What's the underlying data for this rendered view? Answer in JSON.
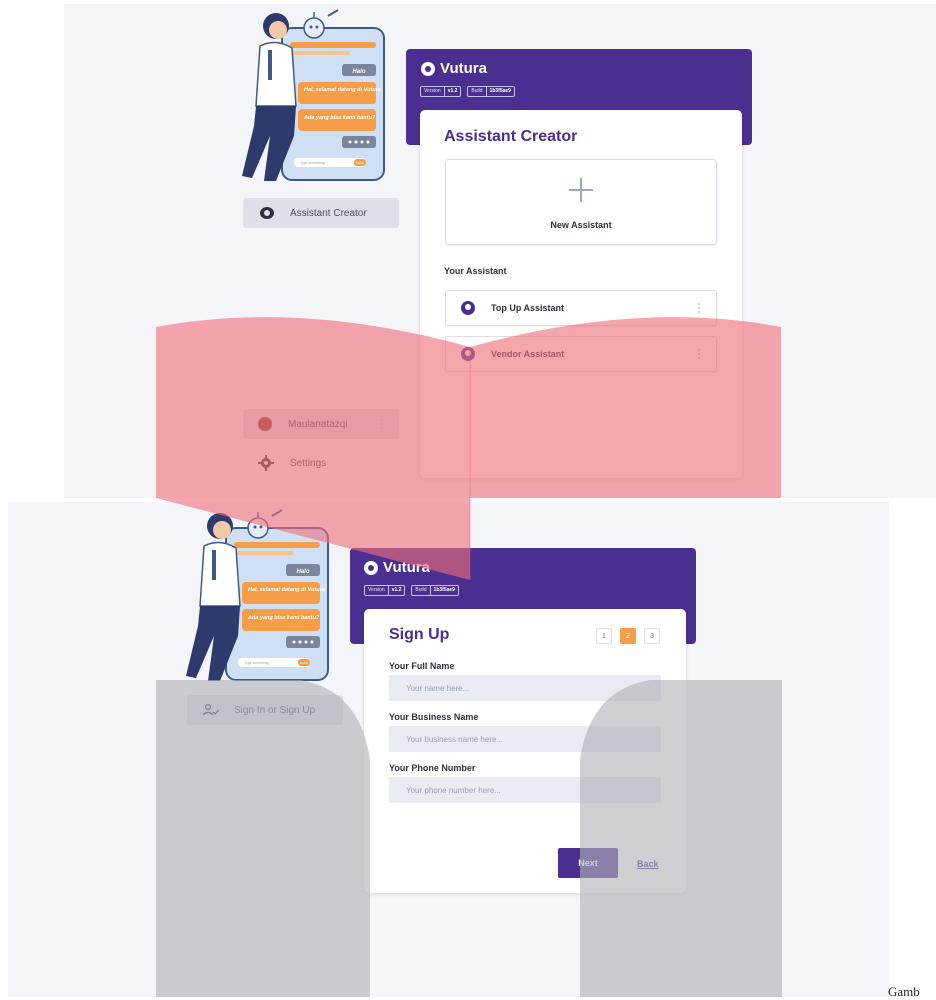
{
  "top": {
    "brand": "Vutura",
    "version_label": "Version",
    "version_value": "v1.2",
    "build_label": "Build",
    "build_value": "1b3f5ae9",
    "illustration": {
      "bubble_halo": "Halo",
      "bubble_greet": "Hai, selamat datang di Vutura",
      "bubble_ask": "Ada yang bisa kami bantu?",
      "input_hint": "Type something",
      "send": "SEND"
    },
    "nav_active_label": "Assistant Creator",
    "user_name": "Maulanatazqi",
    "settings_label": "Settings",
    "card_title": "Assistant Creator",
    "new_assistant_label": "New Assistant",
    "section_label": "Your Assistant",
    "assistants": [
      {
        "name": "Top Up Assistant"
      },
      {
        "name": "Vendor Assistant"
      }
    ]
  },
  "bottom": {
    "brand": "Vutura",
    "version_label": "Version",
    "version_value": "v1.2",
    "build_label": "Build",
    "build_value": "1b3f5ae9",
    "illustration": {
      "bubble_halo": "Halo",
      "bubble_greet": "Hai, selamat datang di Vutura",
      "bubble_ask": "Ada yang bisa kami bantu?",
      "input_hint": "Type something",
      "send": "SEND"
    },
    "nav_active_label": "Sign In or Sign Up",
    "card_title": "Sign Up",
    "steps": [
      "1",
      "2",
      "3"
    ],
    "active_step": 2,
    "fields": [
      {
        "label": "Your Full Name",
        "placeholder": "Your name here..."
      },
      {
        "label": "Your Business Name",
        "placeholder": "Your business name here..."
      },
      {
        "label": "Your Phone Number",
        "placeholder": "Your phone number here..."
      }
    ],
    "next_label": "Next",
    "back_label": "Back"
  },
  "caption": "Gamb",
  "colors": {
    "brand_purple": "#4a2f90",
    "accent_orange": "#f59e47",
    "panel_bg": "#f4f5f9",
    "overlay_red": "#ef6f7a",
    "overlay_gray": "#b0b2b8"
  }
}
